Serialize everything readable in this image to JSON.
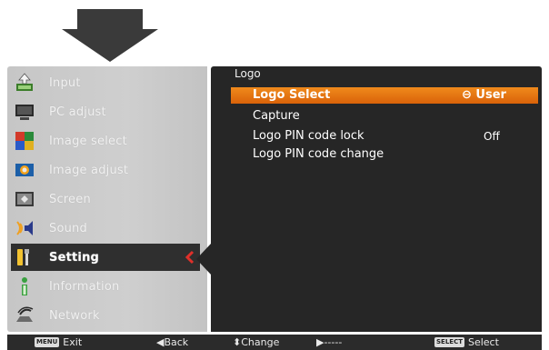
{
  "menu": {
    "items": [
      {
        "label": "Input",
        "icon": "input-icon"
      },
      {
        "label": "PC adjust",
        "icon": "pc-adjust-icon"
      },
      {
        "label": "Image select",
        "icon": "image-select-icon"
      },
      {
        "label": "Image adjust",
        "icon": "image-adjust-icon"
      },
      {
        "label": "Screen",
        "icon": "screen-icon"
      },
      {
        "label": "Sound",
        "icon": "sound-icon"
      },
      {
        "label": "Setting",
        "icon": "setting-icon",
        "active": true
      },
      {
        "label": "Information",
        "icon": "information-icon"
      },
      {
        "label": "Network",
        "icon": "network-icon"
      }
    ]
  },
  "submenu": {
    "title": "Logo",
    "options": [
      {
        "label": "Logo Select",
        "value": "⊖ User",
        "selected": true
      },
      {
        "label": "Capture",
        "value": ""
      },
      {
        "label": "Logo PIN code lock",
        "value": "Off"
      },
      {
        "label": "Logo PIN code change",
        "value": ""
      }
    ]
  },
  "helpbar": {
    "exit_key": "MENU",
    "exit_label": "Exit",
    "back_label": "◀Back",
    "change_label": "⬍Change",
    "next_label": "▶-----",
    "select_key": "SELECT",
    "select_label": "Select"
  },
  "colors": {
    "accent": "#e8781a",
    "panel_dark": "#262626",
    "panel_light": "#c8c8c8",
    "chevron": "#e0302a"
  }
}
